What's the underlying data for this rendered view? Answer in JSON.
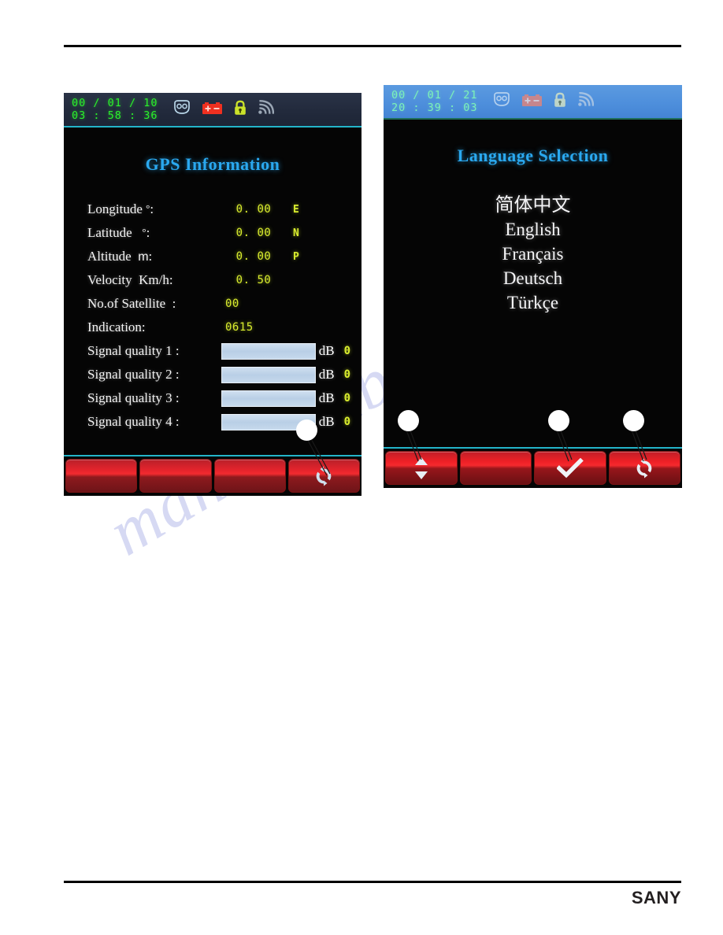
{
  "page": {
    "watermark": "manualslib.com",
    "brand": "SANY"
  },
  "left_panel": {
    "name": "GPS Information screen",
    "statusbar": {
      "date": "00 / 01 / 10",
      "time": "03 : 58 : 36",
      "icons": [
        "seatbelt-icon",
        "battery-icon",
        "lock-icon",
        "signal-icon"
      ]
    },
    "title": "GPS Information",
    "rows": [
      {
        "label": "Longitude",
        "unit": "°",
        "sep": ":",
        "value": "0. 00",
        "dir": "E"
      },
      {
        "label": "Latitude",
        "unit": "°",
        "sep": ":",
        "value": "0. 00",
        "dir": "N"
      },
      {
        "label": "Altitude",
        "unit": "m",
        "sep": ":",
        "value": "0. 00",
        "dir": "P"
      },
      {
        "label": "Velocity",
        "unit": "Km/h",
        "sep": ":",
        "value": "0. 50",
        "dir": ""
      },
      {
        "label": "No.of Satellite",
        "unit": "",
        "sep": ":",
        "value": "00",
        "dir": ""
      },
      {
        "label": "Indication",
        "unit": "",
        "sep": ":",
        "value": "0615",
        "dir": ""
      }
    ],
    "signal_rows": [
      {
        "label": "Signal quality 1 :",
        "unit": "dB",
        "value": "0",
        "fill_pct": 0
      },
      {
        "label": "Signal quality 2 :",
        "unit": "dB",
        "value": "0",
        "fill_pct": 0
      },
      {
        "label": "Signal quality 3 :",
        "unit": "dB",
        "value": "0",
        "fill_pct": 0
      },
      {
        "label": "Signal quality 4 :",
        "unit": "dB",
        "value": "0",
        "fill_pct": 0
      }
    ],
    "buttons": [
      {
        "name": "soft-button-1",
        "icon": ""
      },
      {
        "name": "soft-button-2",
        "icon": ""
      },
      {
        "name": "soft-button-3",
        "icon": ""
      },
      {
        "name": "soft-button-return",
        "icon": "return-icon"
      }
    ],
    "callouts": [
      {
        "label": ""
      }
    ]
  },
  "right_panel": {
    "name": "Language Selection screen",
    "statusbar": {
      "date": "00 / 01 / 21",
      "time": "20 : 39 : 03",
      "icons": [
        "seatbelt-icon",
        "battery-icon",
        "lock-icon",
        "signal-icon"
      ]
    },
    "title": "Language Selection",
    "languages": [
      {
        "label": "简体中文",
        "script": "cjk"
      },
      {
        "label": "English",
        "script": "latin"
      },
      {
        "label": "Français",
        "script": "latin"
      },
      {
        "label": "Deutsch",
        "script": "latin"
      },
      {
        "label": "Türkçe",
        "script": "latin"
      }
    ],
    "buttons": [
      {
        "name": "soft-button-updown",
        "icon": "up-down-arrow-icon"
      },
      {
        "name": "soft-button-blank",
        "icon": ""
      },
      {
        "name": "soft-button-confirm",
        "icon": "check-icon"
      },
      {
        "name": "soft-button-return",
        "icon": "return-icon"
      }
    ],
    "callouts": [
      {
        "label": ""
      },
      {
        "label": ""
      },
      {
        "label": ""
      }
    ]
  },
  "colors": {
    "accent_blue": "#2aa8ef",
    "value_yellow": "#d8ec2e",
    "clock_green": "#2bf02b",
    "button_red": "#ee2026",
    "statusbar_blue": "#4e8fdc",
    "bar_fill": "#bfd4e8"
  }
}
